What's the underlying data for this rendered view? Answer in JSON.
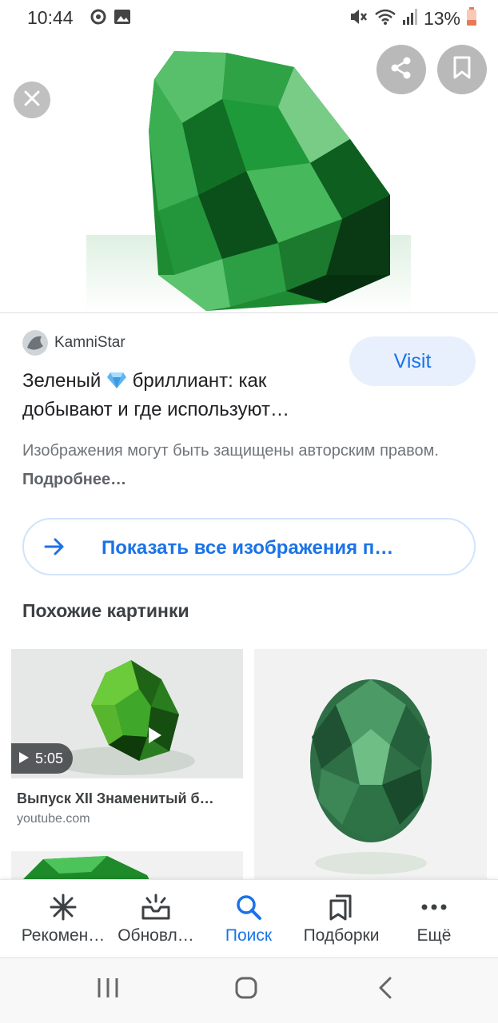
{
  "status_bar": {
    "time": "10:44",
    "battery": "13%",
    "icons_left": [
      "sync-icon",
      "image-icon"
    ],
    "icons_right": [
      "mute-icon",
      "wifi-icon",
      "signal-icon",
      "battery-icon"
    ]
  },
  "hero": {
    "image": "green-diamond-image",
    "close_icon": "close-icon",
    "share_icon": "share-icon",
    "bookmark_icon": "bookmark-icon"
  },
  "result": {
    "source_name": "KamniStar",
    "visit_label": "Visit",
    "title_part1": "Зеленый ",
    "title_part2": " бриллиант: как добывают и где используют…",
    "copyright_text": "Изображения могут быть защищены авторским правом. ",
    "copyright_more": "Подробнее…"
  },
  "show_all": {
    "label": "Показать все изображения п…"
  },
  "similar": {
    "title": "Похожие картинки",
    "items": [
      {
        "duration": "5:05",
        "title": "Выпуск XII Знаменитый б…",
        "source": "youtube.com"
      }
    ]
  },
  "bottom_nav": {
    "items": [
      {
        "label": "Рекомен…",
        "icon": "asterisk-icon"
      },
      {
        "label": "Обновл…",
        "icon": "updates-icon"
      },
      {
        "label": "Поиск",
        "icon": "search-icon"
      },
      {
        "label": "Подборки",
        "icon": "collections-icon"
      },
      {
        "label": "Ещё",
        "icon": "more-icon"
      }
    ],
    "active_index": 2
  },
  "colors": {
    "accent": "#1a73e8",
    "visit_bg": "#e8f0fe",
    "text_primary": "#202124",
    "text_secondary": "#70757a"
  }
}
